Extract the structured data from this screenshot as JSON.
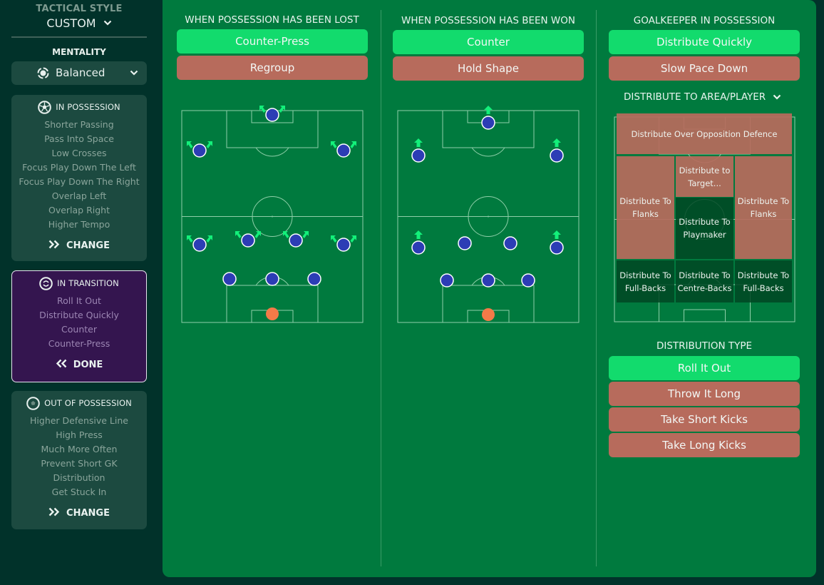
{
  "sidebar": {
    "tactical_style_label": "TACTICAL STYLE",
    "tactical_style_value": "CUSTOM",
    "mentality_label": "MENTALITY",
    "mentality_value": "Balanced",
    "in_possession": {
      "title": "IN POSSESSION",
      "items": [
        "Shorter Passing",
        "Pass Into Space",
        "Low Crosses",
        "Focus Play Down The Left",
        "Focus Play Down The Right",
        "Overlap Left",
        "Overlap Right",
        "Higher Tempo"
      ],
      "action": "CHANGE"
    },
    "in_transition": {
      "title": "IN TRANSITION",
      "items": [
        "Roll It Out",
        "Distribute Quickly",
        "Counter",
        "Counter-Press"
      ],
      "action": "DONE"
    },
    "out_of_possession": {
      "title": "OUT OF POSSESSION",
      "items": [
        "Higher Defensive Line",
        "High Press",
        "Much More Often",
        "Prevent Short GK",
        "Distribution",
        "Get Stuck In"
      ],
      "action": "CHANGE"
    }
  },
  "columns": {
    "lost": {
      "title": "WHEN POSSESSION HAS BEEN LOST",
      "options": [
        {
          "label": "Counter-Press",
          "selected": true
        },
        {
          "label": "Regroup",
          "selected": false
        }
      ]
    },
    "won": {
      "title": "WHEN POSSESSION HAS BEEN WON",
      "options": [
        {
          "label": "Counter",
          "selected": true
        },
        {
          "label": "Hold Shape",
          "selected": false
        }
      ]
    },
    "goalkeeper": {
      "title": "GOALKEEPER IN POSSESSION",
      "options": [
        {
          "label": "Distribute Quickly",
          "selected": true
        },
        {
          "label": "Slow Pace Down",
          "selected": false
        }
      ],
      "distribute_title": "DISTRIBUTE TO AREA/PLAYER",
      "zones": {
        "over_defence": "Distribute Over Opposition Defence",
        "target": "Distribute to Target...",
        "flanks_left": "Distribute To Flanks",
        "flanks_right": "Distribute To Flanks",
        "playmaker": "Distribute To Playmaker",
        "fullbacks_left": "Distribute To Full-Backs",
        "centrebacks": "Distribute To Centre-Backs",
        "fullbacks_right": "Distribute To Full-Backs"
      },
      "selected_zones": [
        "playmaker",
        "fullbacks_left",
        "centrebacks",
        "fullbacks_right"
      ],
      "distribution_type_title": "DISTRIBUTION TYPE",
      "distribution_types": [
        {
          "label": "Roll It Out",
          "selected": true
        },
        {
          "label": "Throw It Long",
          "selected": false
        },
        {
          "label": "Take Short Kicks",
          "selected": false
        },
        {
          "label": "Take Long Kicks",
          "selected": false
        }
      ]
    }
  },
  "colors": {
    "background": "#01322a",
    "panel": "#007a3e",
    "selected": "#12db6d",
    "unselected": "#b76b5c",
    "player": "#2c3db5",
    "goalkeeper": "#f37a48",
    "arrow": "#13f07a",
    "transition_card": "#34154f"
  }
}
